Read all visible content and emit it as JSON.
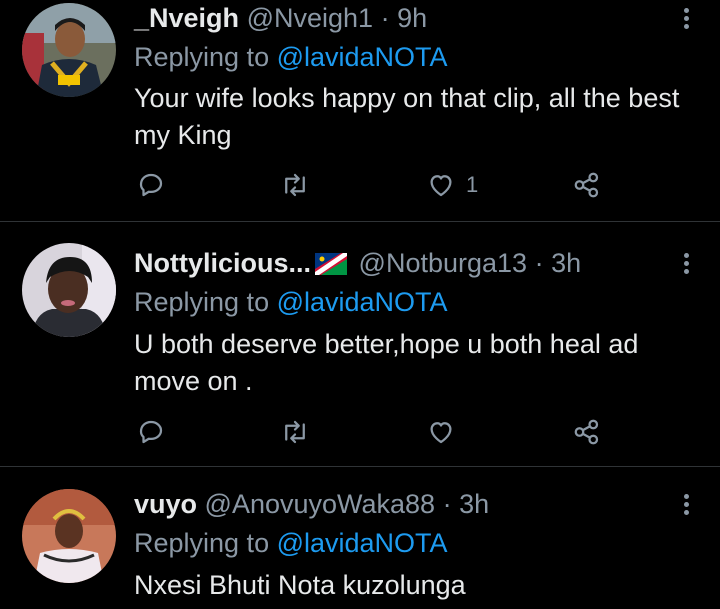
{
  "tweets": [
    {
      "name": "_Nveigh",
      "handle": "@Nveigh1",
      "separator": "·",
      "time": "9h",
      "replying_prefix": "Replying to ",
      "replying_to": "@lavidaNOTA",
      "text": "Your wife looks happy on that clip, all the best my King",
      "likes": "1"
    },
    {
      "name": "Nottylicious...",
      "handle": "@Notburga13",
      "separator": "·",
      "time": "3h",
      "replying_prefix": "Replying to ",
      "replying_to": "@lavidaNOTA",
      "text": "U both deserve better,hope u both heal ad move on .",
      "likes": ""
    },
    {
      "name": "vuyo",
      "handle": "@AnovuyoWaka88",
      "separator": "·",
      "time": "3h",
      "replying_prefix": "Replying to ",
      "replying_to": "@lavidaNOTA",
      "text": "Nxesi Bhuti Nota kuzolunga",
      "likes": ""
    }
  ],
  "colors": {
    "background": "#000000",
    "text": "#e7e9ea",
    "secondary": "#8b98a5",
    "accent": "#1d9bf0",
    "divider": "#2f3336"
  },
  "icons": [
    "reply-icon",
    "retweet-icon",
    "like-icon",
    "share-icon",
    "more-icon",
    "namibia-flag-icon"
  ]
}
